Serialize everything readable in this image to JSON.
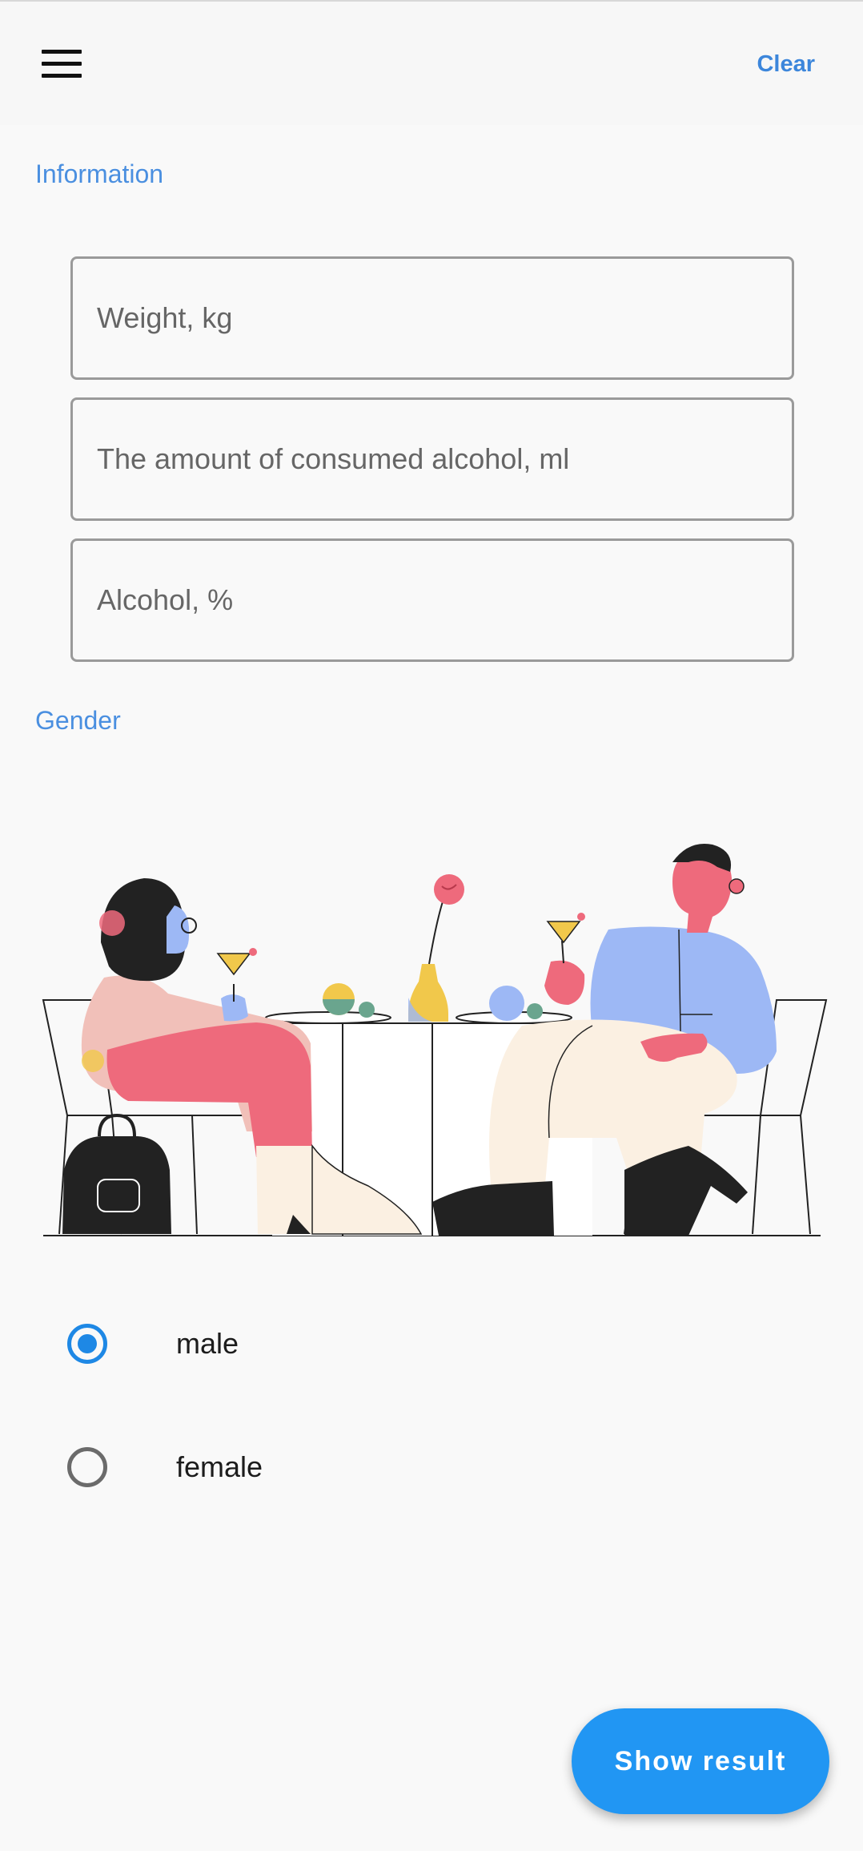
{
  "appbar": {
    "menu_icon": "menu-icon",
    "clear_label": "Clear"
  },
  "information": {
    "section_label": "Information",
    "weight_placeholder": "Weight, kg",
    "amount_placeholder": "The amount of consumed alcohol, ml",
    "percent_placeholder": "Alcohol, %",
    "weight_value": "",
    "amount_value": "",
    "percent_value": ""
  },
  "gender": {
    "section_label": "Gender",
    "illustration": "couple-at-table-illustration",
    "options": [
      {
        "label": "male",
        "selected": true
      },
      {
        "label": "female",
        "selected": false
      }
    ]
  },
  "actions": {
    "show_result_label": "Show result"
  },
  "colors": {
    "accent": "#2196f3",
    "label_blue": "#4a8fe0",
    "radio_on": "#1e88e5"
  }
}
